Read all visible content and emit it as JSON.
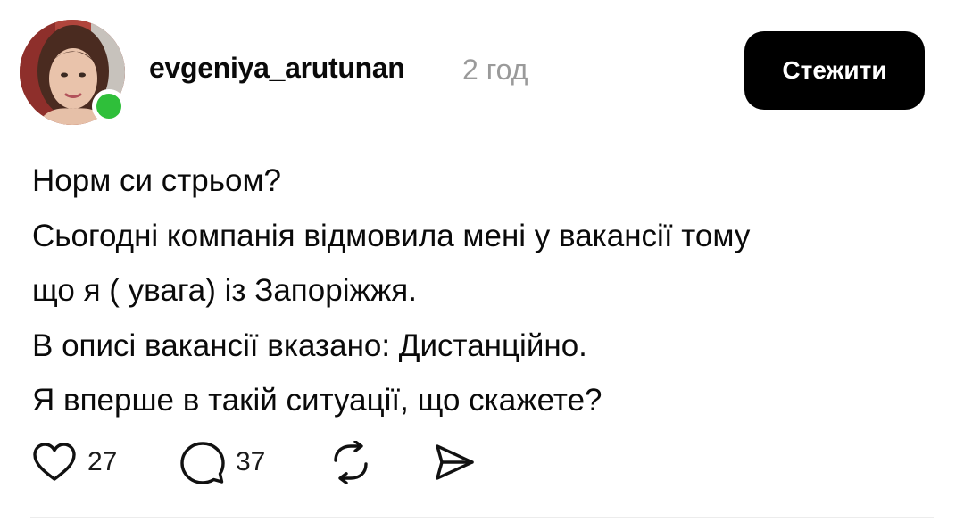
{
  "post": {
    "author": {
      "username": "evgeniya_arutunan",
      "online_status_color": "#2fbf3a"
    },
    "time_ago": "2 год",
    "follow_label": "Стежити",
    "lines": [
      "Норм си стрьом?",
      "Сьогодні компанія відмовила мені у вакансії тому",
      "що я ( увага) із Запоріжжя.",
      "В описі вакансії вказано: Дистанційно.",
      "Я вперше в такій ситуації, що скажете?"
    ],
    "actions": {
      "likes": "27",
      "comments": "37",
      "like_icon": "heart-icon",
      "comment_icon": "speech-bubble-icon",
      "repost_icon": "repost-icon",
      "share_icon": "send-icon"
    }
  }
}
